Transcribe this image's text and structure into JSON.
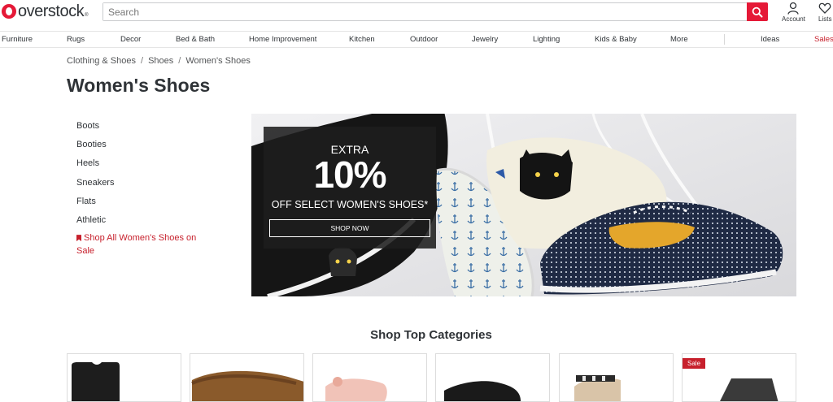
{
  "header": {
    "logo_text": "overstock",
    "logo_tm": "®",
    "search_placeholder": "Search",
    "account_label": "Account",
    "lists_label": "Lists"
  },
  "nav": {
    "items": [
      "Furniture",
      "Rugs",
      "Decor",
      "Bed & Bath",
      "Home Improvement",
      "Kitchen",
      "Outdoor",
      "Jewelry",
      "Lighting",
      "Kids & Baby",
      "More"
    ],
    "ideas": "Ideas",
    "sales": "Sales"
  },
  "breadcrumb": [
    "Clothing & Shoes",
    "Shoes",
    "Women's Shoes"
  ],
  "breadcrumb_sep": "/",
  "page_title": "Women's Shoes",
  "sidebar": {
    "items": [
      "Boots",
      "Booties",
      "Heels",
      "Sneakers",
      "Flats",
      "Athletic"
    ],
    "sale_link": "Shop All Women's Shoes on Sale"
  },
  "banner": {
    "extra": "EXTRA",
    "percent": "10%",
    "subtitle": "OFF SELECT WOMEN'S SHOES*",
    "button": "SHOP NOW"
  },
  "categories": {
    "heading": "Shop Top Categories",
    "sale_badge": "Sale"
  },
  "colors": {
    "brand_red": "#e51937",
    "sale_red": "#c7202c",
    "text": "#2f3337"
  }
}
